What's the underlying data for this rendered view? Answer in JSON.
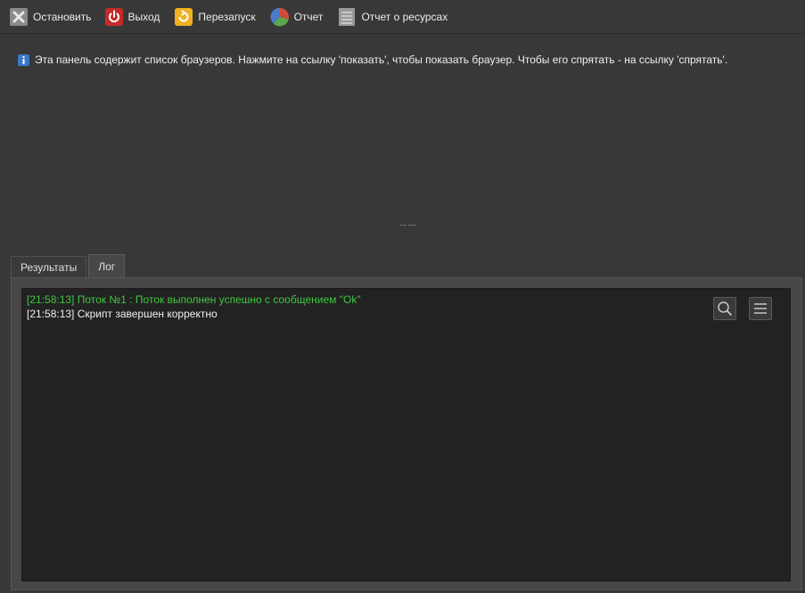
{
  "toolbar": {
    "items": [
      {
        "label": "Остановить",
        "icon": "stop-x-icon"
      },
      {
        "label": "Выход",
        "icon": "power-icon"
      },
      {
        "label": "Перезапуск",
        "icon": "restart-icon"
      },
      {
        "label": "Отчет",
        "icon": "pie-chart-icon"
      },
      {
        "label": "Отчет о ресурсах",
        "icon": "document-list-icon"
      }
    ]
  },
  "browsers_panel": {
    "info_text": "Эта панель содержит список браузеров. Нажмите на ссылку 'показать', чтобы показать браузер. Чтобы его спрятать - на ссылку 'спрятать'."
  },
  "tabs": [
    {
      "label": "Результаты",
      "active": false
    },
    {
      "label": "Лог",
      "active": true
    }
  ],
  "log": {
    "lines": [
      {
        "text": "[21:58:13] Поток №1 : Поток выполнен успешно с сообщением \"Ok\"",
        "color": "#3ec93e"
      },
      {
        "text": "[21:58:13] Скрипт завершен корректно",
        "color": "#f0f0f0"
      }
    ],
    "search_button_icon": "search-icon",
    "menu_button_icon": "menu-icon"
  }
}
